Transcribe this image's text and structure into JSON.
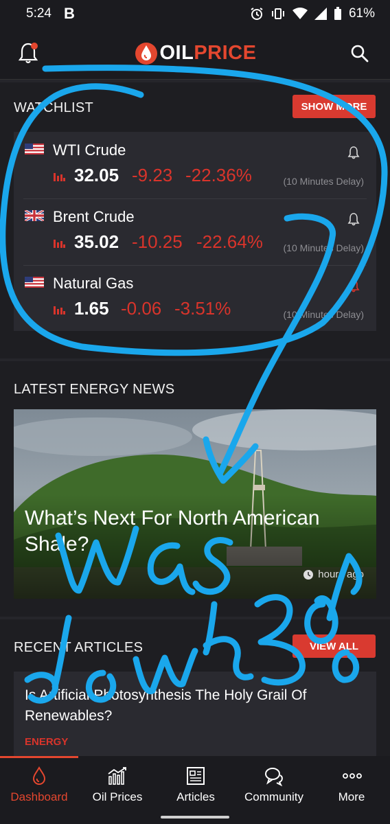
{
  "status": {
    "time": "5:24",
    "app_letter": "B",
    "battery": "61%"
  },
  "header": {
    "logo_oil": "OIL",
    "logo_price": "PRICE",
    "icons": [
      "bell-icon",
      "search-icon"
    ],
    "accent": "#e4472f"
  },
  "watchlist": {
    "title": "WATCHLIST",
    "show_more": "SHOW MORE",
    "items": [
      {
        "name": "WTI Crude",
        "flag": "us",
        "price": "32.05",
        "change": "-9.23",
        "percent": "-22.36%",
        "delay": "(10 Minutes Delay)",
        "alert_active": false
      },
      {
        "name": "Brent Crude",
        "flag": "uk",
        "price": "35.02",
        "change": "-10.25",
        "percent": "-22.64%",
        "delay": "(10 Minutes Delay)",
        "alert_active": false
      },
      {
        "name": "Natural Gas",
        "flag": "us",
        "price": "1.65",
        "change": "-0.06",
        "percent": "-3.51%",
        "delay": "(10 Minutes Delay)",
        "alert_active": true
      }
    ]
  },
  "latest_news": {
    "title": "LATEST ENERGY NEWS",
    "headline": "What’s Next For North American Shale?",
    "time": "hours ago"
  },
  "recent_articles": {
    "title": "RECENT ARTICLES",
    "view_all": "VIEW ALL",
    "article_title": "Is Artificial Photosynthesis The Holy Grail Of Renewables?",
    "category": "ENERGY"
  },
  "nav": {
    "items": [
      {
        "label": "Dashboard",
        "icon": "drop-icon",
        "active": true
      },
      {
        "label": "Oil Prices",
        "icon": "chart-icon",
        "active": false
      },
      {
        "label": "Articles",
        "icon": "newspaper-icon",
        "active": false
      },
      {
        "label": "Community",
        "icon": "chat-icon",
        "active": false
      },
      {
        "label": "More",
        "icon": "more-icon",
        "active": false
      }
    ]
  }
}
